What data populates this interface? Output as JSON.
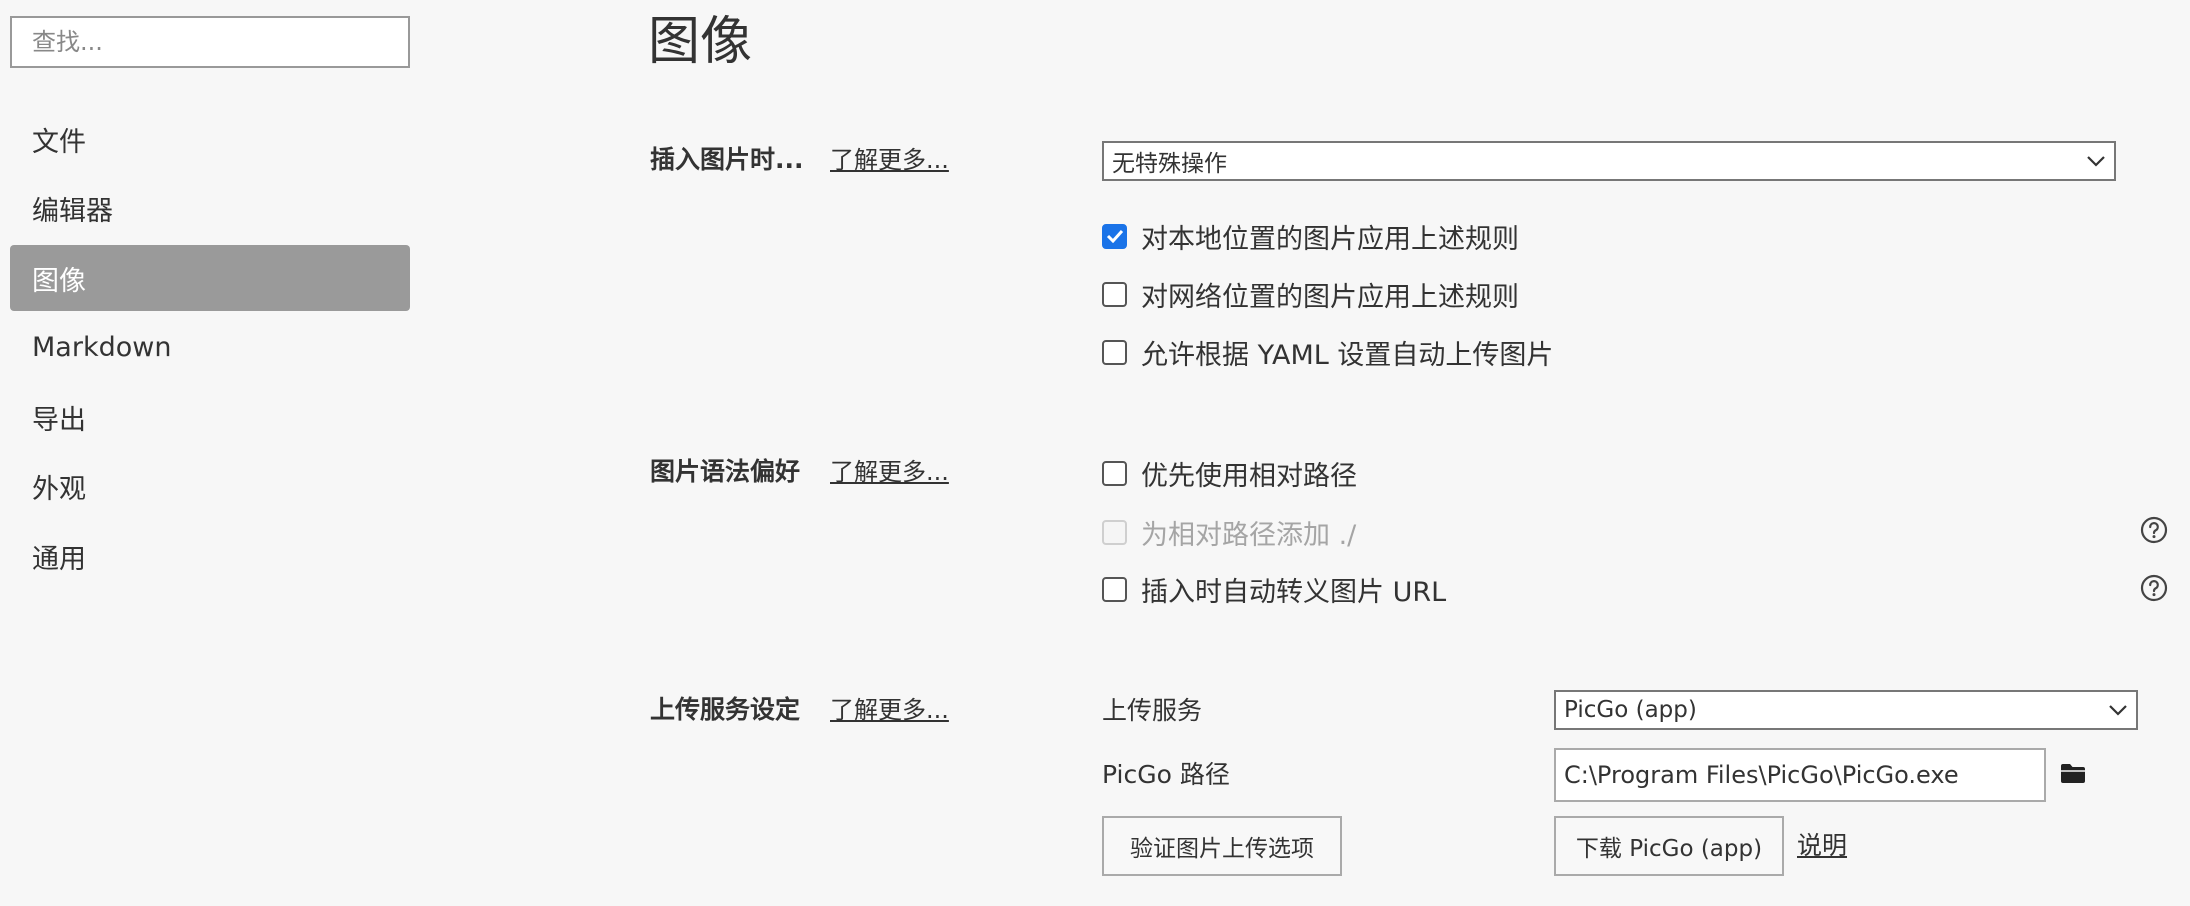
{
  "search": {
    "placeholder": "查找..."
  },
  "sidebar": {
    "items": [
      {
        "label": "文件"
      },
      {
        "label": "编辑器"
      },
      {
        "label": "图像"
      },
      {
        "label": "Markdown"
      },
      {
        "label": "导出"
      },
      {
        "label": "外观"
      },
      {
        "label": "通用"
      }
    ],
    "active_index": 2
  },
  "page": {
    "title": "图像"
  },
  "insert_section": {
    "title": "插入图片时...",
    "learn_more": "了解更多...",
    "action_select": {
      "value": "无特殊操作"
    },
    "options": [
      {
        "label": "对本地位置的图片应用上述规则",
        "checked": true
      },
      {
        "label": "对网络位置的图片应用上述规则",
        "checked": false
      },
      {
        "label": "允许根据 YAML 设置自动上传图片",
        "checked": false
      }
    ]
  },
  "syntax_section": {
    "title": "图片语法偏好",
    "learn_more": "了解更多...",
    "options": [
      {
        "label": "优先使用相对路径",
        "checked": false,
        "disabled": false
      },
      {
        "label": "为相对路径添加 ./",
        "checked": false,
        "disabled": true
      },
      {
        "label": "插入时自动转义图片 URL",
        "checked": false,
        "disabled": false
      }
    ]
  },
  "upload_section": {
    "title": "上传服务设定",
    "learn_more": "了解更多...",
    "service_label": "上传服务",
    "service_select": {
      "value": "PicGo (app)"
    },
    "path_label": "PicGo 路径",
    "path_value": "C:\\Program Files\\PicGo\\PicGo.exe",
    "verify_button": "验证图片上传选项",
    "download_button": "下载 PicGo (app)",
    "help_link": "说明"
  },
  "colors": {
    "background": "#f7f7f7",
    "active_nav": "#9a9a9a",
    "checkbox_checked": "#1a73e8"
  },
  "icons": {
    "dropdown": "chevron-down-icon",
    "help": "question-circle-icon",
    "folder": "folder-icon",
    "checkmark": "checkmark-icon"
  }
}
